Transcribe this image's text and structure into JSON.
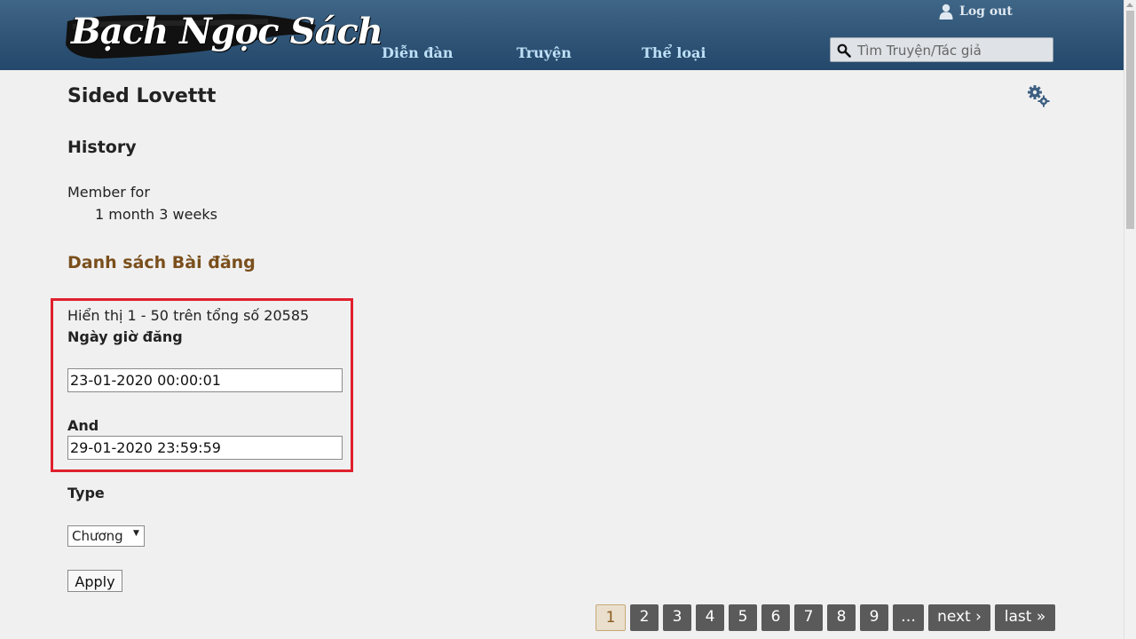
{
  "header": {
    "logo_text": "Bạch Ngọc Sách",
    "logout_label": "Log out",
    "nav": [
      "Diễn đàn",
      "Truyện",
      "Thể loại"
    ],
    "search_placeholder": "Tìm Truyện/Tác giả"
  },
  "profile": {
    "name": "Sided Lovettt",
    "history_title": "History",
    "member_for_label": "Member for",
    "member_for_value": "1 month 3 weeks"
  },
  "posts": {
    "title": "Danh sách Bài đăng",
    "showing_text": "Hiển thị 1 - 50 trên tổng số 20585",
    "date_label": "Ngày giờ đăng",
    "date_from": "23-01-2020 00:00:01",
    "and_label": "And",
    "date_to": "29-01-2020 23:59:59",
    "type_label": "Type",
    "type_selected": "Chương",
    "apply_label": "Apply"
  },
  "pager": {
    "current": "1",
    "pages": [
      "1",
      "2",
      "3",
      "4",
      "5",
      "6",
      "7",
      "8",
      "9",
      "…",
      "next ›",
      "last »"
    ]
  },
  "colors": {
    "header_bg": "#2f5476",
    "nav_text": "#bfe0f7",
    "section_title": "#7a4f1c",
    "highlight_border": "#e0202e",
    "pager_bg": "#5a5a5a",
    "pager_current_bg": "#e9dfcc"
  }
}
